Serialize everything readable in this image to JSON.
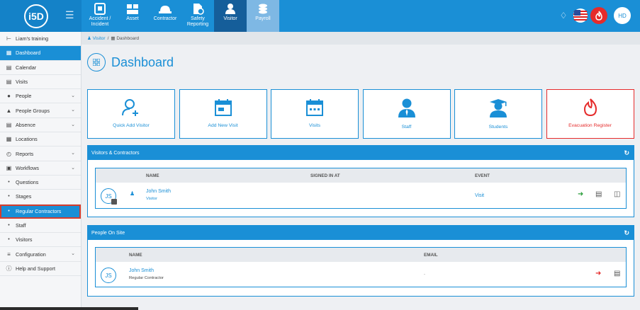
{
  "modules": [
    {
      "label": "Accident / Incident",
      "icon": "accident-icon"
    },
    {
      "label": "Asset",
      "icon": "asset-icon"
    },
    {
      "label": "Contractor",
      "icon": "hardhat-icon"
    },
    {
      "label": "Safety Reporting",
      "icon": "safety-reporting-icon"
    },
    {
      "label": "Visitor",
      "icon": "person-icon"
    },
    {
      "label": "Payroll",
      "icon": "coins-icon"
    }
  ],
  "user_initials": "HD",
  "sidebar": {
    "org": "Liam's training",
    "items": [
      {
        "label": "Dashboard",
        "icon": "grid-icon"
      },
      {
        "label": "Calendar",
        "icon": "calendar-icon"
      },
      {
        "label": "Visits",
        "icon": "visits-icon"
      },
      {
        "label": "People",
        "icon": "people-icon"
      },
      {
        "label": "People Groups",
        "icon": "people-groups-icon"
      },
      {
        "label": "Absence",
        "icon": "absence-icon"
      },
      {
        "label": "Locations",
        "icon": "building-icon"
      },
      {
        "label": "Reports",
        "icon": "reports-icon"
      },
      {
        "label": "Workflows",
        "icon": "workflows-icon"
      },
      {
        "label": "Questions",
        "icon": "dot-icon"
      },
      {
        "label": "Stages",
        "icon": "dot-icon"
      },
      {
        "label": "Regular Contractors",
        "icon": "dot-icon"
      },
      {
        "label": "Staff",
        "icon": "dot-icon"
      },
      {
        "label": "Visitors",
        "icon": "dot-icon"
      },
      {
        "label": "Configuration",
        "icon": "configuration-icon"
      },
      {
        "label": "Help and Support",
        "icon": "help-icon"
      }
    ]
  },
  "breadcrumb": {
    "visitor": "Visitor",
    "sep": "/",
    "current": "Dashboard"
  },
  "page_title": "Dashboard",
  "cards": [
    {
      "label": "Quick Add Visitor",
      "icon": "add-person-icon"
    },
    {
      "label": "Add New Visit",
      "icon": "calendar-icon"
    },
    {
      "label": "Visits",
      "icon": "calendar-dots-icon"
    },
    {
      "label": "Staff",
      "icon": "staff-icon"
    },
    {
      "label": "Students",
      "icon": "graduate-icon"
    },
    {
      "label": "Evacuation Register",
      "icon": "fire-icon"
    }
  ],
  "visitors_panel": {
    "title": "Visitors & Contractors",
    "columns": {
      "name": "NAME",
      "signed_in": "SIGNED IN AT",
      "event": "EVENT"
    },
    "row": {
      "initials": "JS",
      "name": "John Smith",
      "role": "Visitor",
      "event": "Visit"
    }
  },
  "onsite_panel": {
    "title": "People On Site",
    "columns": {
      "name": "NAME",
      "email": "EMAIL"
    },
    "row": {
      "initials": "JS",
      "name": "John Smith",
      "role": "Regular Contractor",
      "email": "-"
    }
  }
}
